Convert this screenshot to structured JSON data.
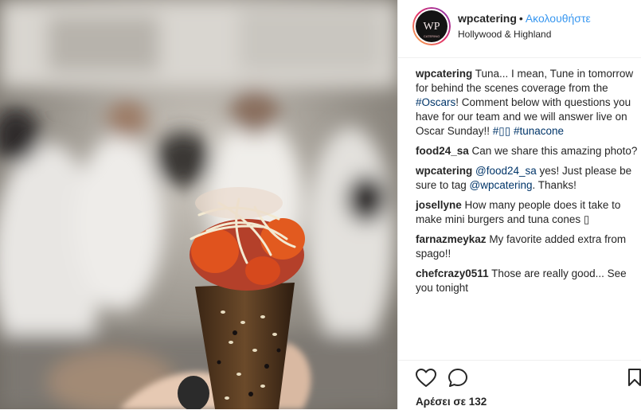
{
  "post": {
    "username": "wpcatering",
    "dot": "•",
    "follow_label": "Ακολουθήστε",
    "location": "Hollywood & Highland",
    "avatar_letters": "WP",
    "avatar_subtext": "CATERING"
  },
  "caption": {
    "user": "wpcatering",
    "text_1": " Tuna... I mean, Tune in tomorrow for behind the scenes coverage from the ",
    "tag_oscars": "#Oscars",
    "text_2": "! Comment below with questions you have for our team and we will answer live on Oscar Sunday!! ",
    "emoji_tag": "#▯▯",
    "tag_tunacone": "#tunacone"
  },
  "comments": [
    {
      "user": "food24_sa",
      "text": " Can we share this amazing photo?"
    },
    {
      "user": "wpcatering",
      "mention": "@food24_sa",
      "text": " yes! Just please be sure to tag ",
      "mention2": "@wpcatering",
      "text2": ". Thanks!"
    },
    {
      "user": "josellyne",
      "text": " How many people does it take to make mini burgers and tuna cones ▯"
    },
    {
      "user": "farnazmeykaz",
      "text": " My favorite added extra from spago!!"
    },
    {
      "user": "chefcrazy0511",
      "text": " Those are really good... See you tonight"
    }
  ],
  "actions": {
    "likes_text": "Αρέσει σε 132",
    "like_icon": "heart-icon",
    "comment_icon": "comment-bubble-icon",
    "save_icon": "bookmark-icon"
  },
  "colors": {
    "link": "#003569",
    "follow": "#3897f0",
    "text": "#262626",
    "border": "#efefef"
  }
}
